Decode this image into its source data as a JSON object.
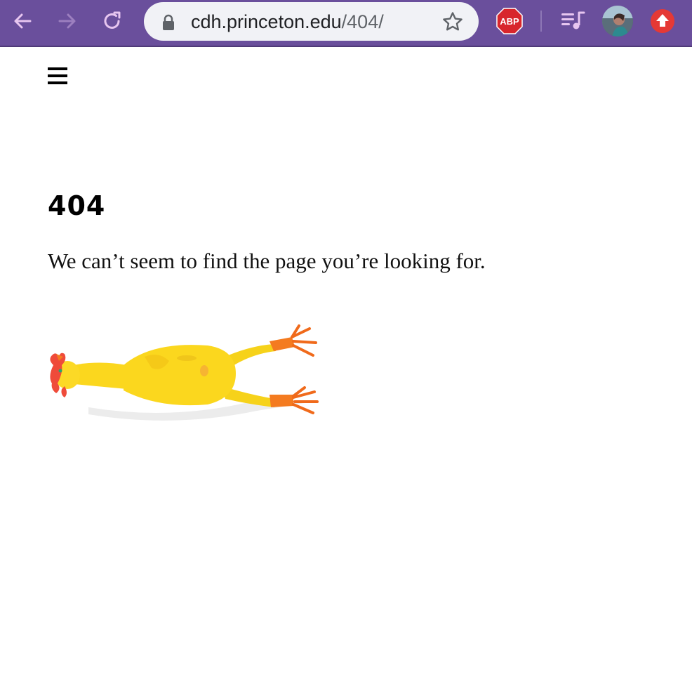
{
  "browser": {
    "url_host": "cdh.princeton.edu",
    "url_path": "/404/",
    "toolbar_color": "#6a4f9c",
    "icons": {
      "back": "back-arrow-icon",
      "forward": "forward-arrow-icon",
      "reload": "reload-icon",
      "lock": "lock-icon",
      "bookmark": "star-icon",
      "adblock": "abp-extension-icon",
      "media": "media-playlist-icon",
      "profile": "profile-avatar",
      "update": "update-arrow-icon"
    },
    "abp_label": "ABP"
  },
  "page": {
    "menu_icon": "hamburger-menu-icon",
    "error_code": "404",
    "message": "We can’t seem to find the page you’re looking for.",
    "illustration": "rubber-chicken-image"
  }
}
